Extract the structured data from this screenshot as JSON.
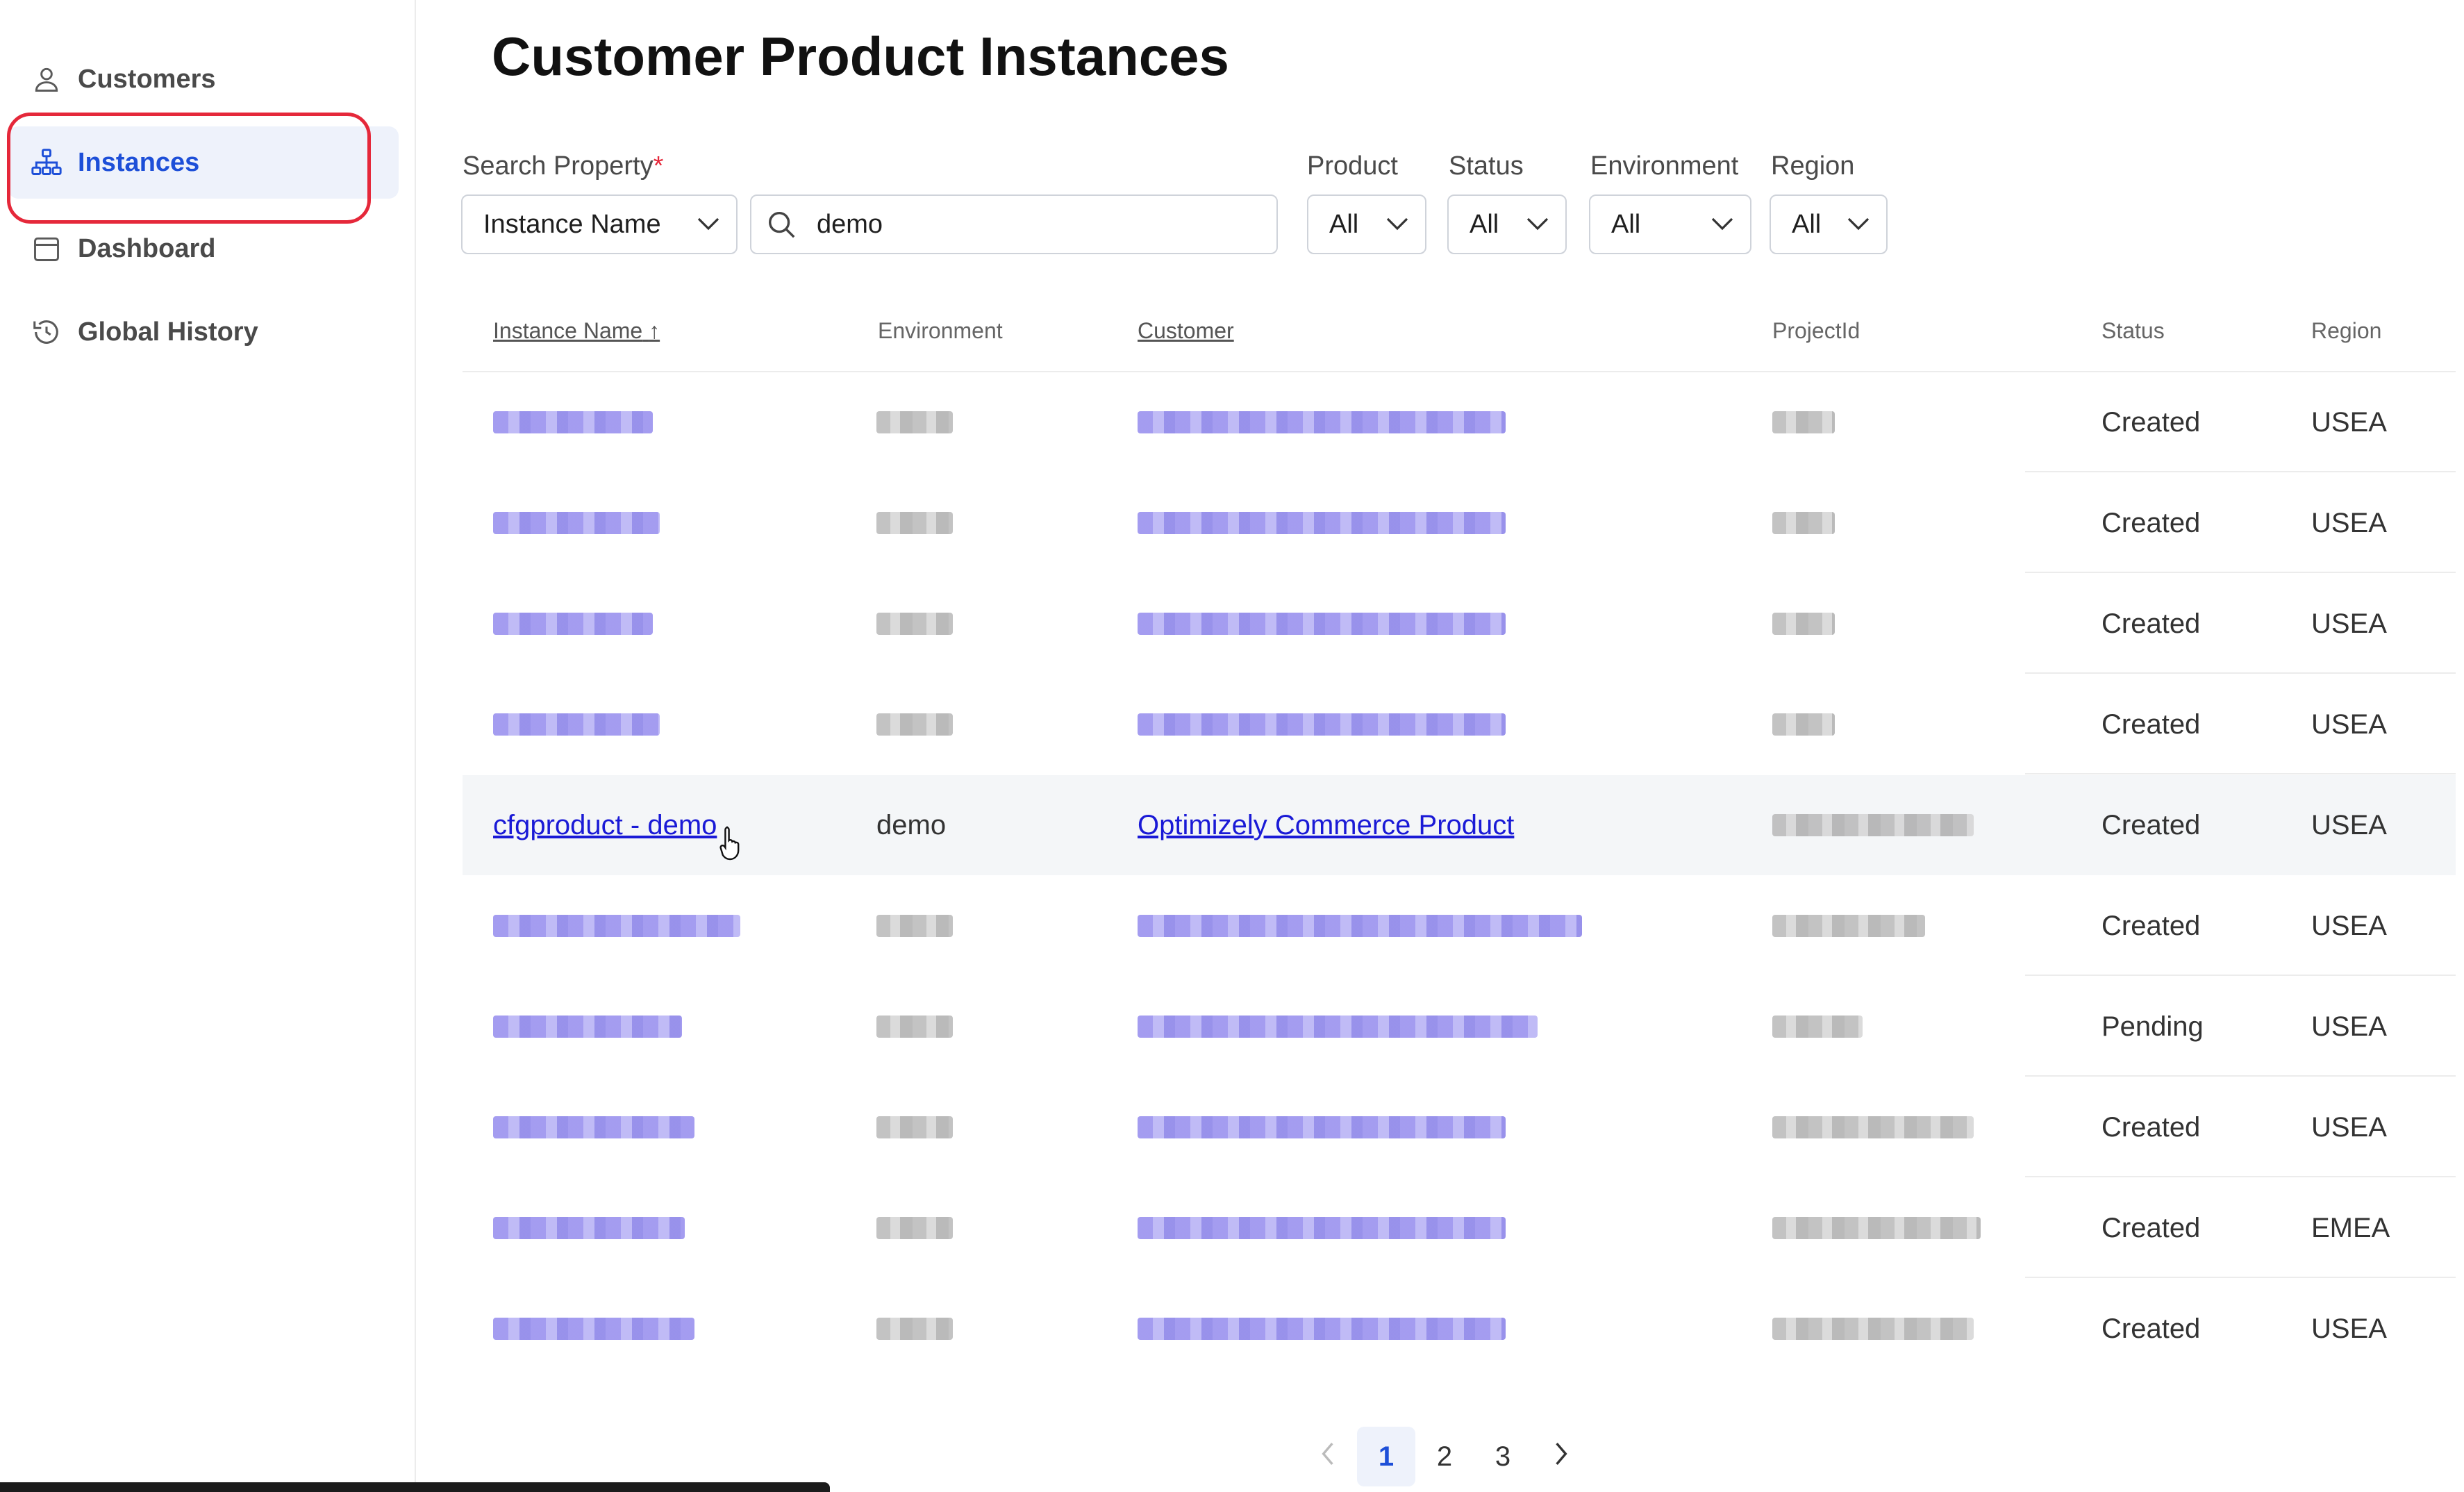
{
  "sidebar": {
    "items": [
      {
        "label": "Customers",
        "icon": "user-icon",
        "active": false
      },
      {
        "label": "Instances",
        "icon": "network-icon",
        "active": true
      },
      {
        "label": "Dashboard",
        "icon": "calendar-icon",
        "active": false
      },
      {
        "label": "Global History",
        "icon": "history-icon",
        "active": false
      }
    ]
  },
  "page": {
    "title": "Customer Product Instances"
  },
  "filters": {
    "search_property_label": "Search Property",
    "required_mark": "*",
    "search_property_value": "Instance Name",
    "search_value": "demo",
    "product_label": "Product",
    "product_value": "All",
    "status_label": "Status",
    "status_value": "All",
    "environment_label": "Environment",
    "environment_value": "All",
    "region_label": "Region",
    "region_value": "All"
  },
  "table": {
    "columns": {
      "instance_name": "Instance Name",
      "environment": "Environment",
      "customer": "Customer",
      "project_id": "ProjectId",
      "status": "Status",
      "region": "Region"
    },
    "sort_indicator": "↑",
    "rows": [
      {
        "instance_name": "",
        "environment": "",
        "customer": "",
        "project_id": "",
        "status": "Created",
        "region": "USEA",
        "redacted": true
      },
      {
        "instance_name": "",
        "environment": "",
        "customer": "",
        "project_id": "",
        "status": "Created",
        "region": "USEA",
        "redacted": true
      },
      {
        "instance_name": "",
        "environment": "",
        "customer": "",
        "project_id": "",
        "status": "Created",
        "region": "USEA",
        "redacted": true
      },
      {
        "instance_name": "",
        "environment": "",
        "customer": "",
        "project_id": "",
        "status": "Created",
        "region": "USEA",
        "redacted": true
      },
      {
        "instance_name": "cfgproduct - demo",
        "environment": "demo",
        "customer": "Optimizely Commerce Product",
        "project_id": "",
        "status": "Created",
        "region": "USEA",
        "redacted": false
      },
      {
        "instance_name": "",
        "environment": "",
        "customer": "",
        "project_id": "",
        "status": "Created",
        "region": "USEA",
        "redacted": true
      },
      {
        "instance_name": "",
        "environment": "",
        "customer": "",
        "project_id": "",
        "status": "Pending",
        "region": "USEA",
        "redacted": true
      },
      {
        "instance_name": "",
        "environment": "",
        "customer": "",
        "project_id": "",
        "status": "Created",
        "region": "USEA",
        "redacted": true
      },
      {
        "instance_name": "",
        "environment": "",
        "customer": "",
        "project_id": "",
        "status": "Created",
        "region": "EMEA",
        "redacted": true
      },
      {
        "instance_name": "",
        "environment": "",
        "customer": "",
        "project_id": "",
        "status": "Created",
        "region": "USEA",
        "redacted": true
      }
    ]
  },
  "pagination": {
    "prev_icon": "chevron-left-icon",
    "next_icon": "chevron-right-icon",
    "pages": [
      "1",
      "2",
      "3"
    ],
    "current": "1"
  },
  "colors": {
    "accent": "#1d4fd8",
    "link": "#1a1ad6",
    "highlight_ring": "#e5283a",
    "active_bg": "#eef2fb"
  }
}
